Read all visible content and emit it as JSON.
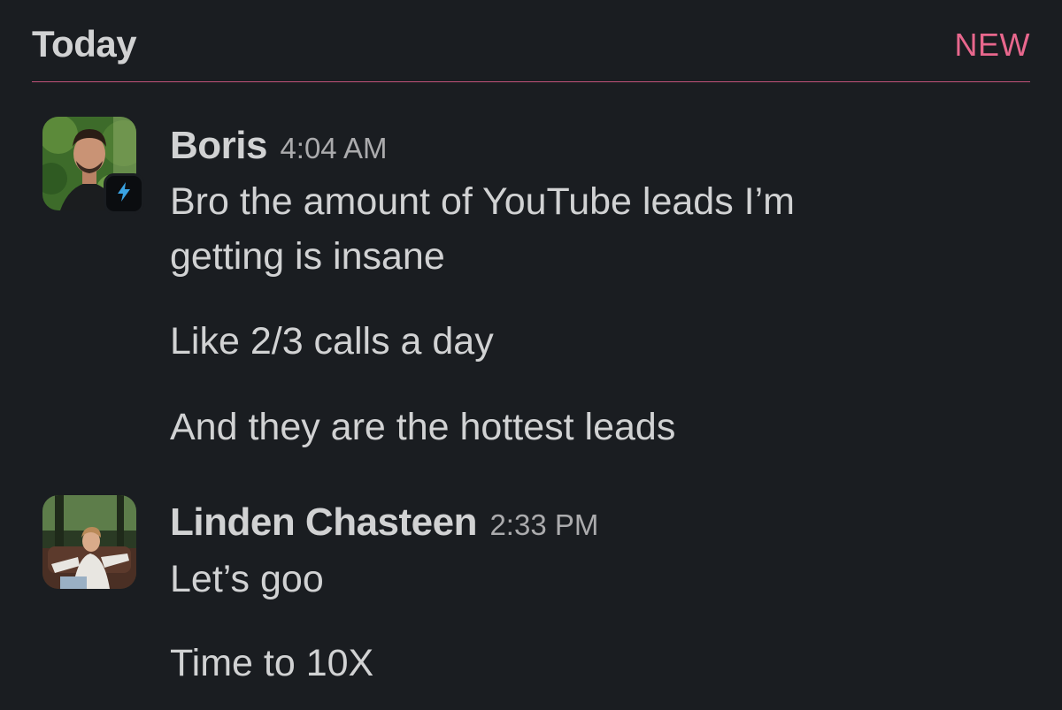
{
  "header": {
    "day_label": "Today",
    "new_label": "NEW",
    "divider_color": "#c2527a",
    "new_color": "#e8678d"
  },
  "messages": [
    {
      "sender": "Boris",
      "time": "4:04 AM",
      "avatar_badge_icon": "lightning-bolt-icon",
      "lines": [
        "Bro the amount of YouTube leads I’m getting is insane",
        "Like 2/3 calls a day",
        "And they are the hottest leads"
      ]
    },
    {
      "sender": "Linden Chasteen",
      "time": "2:33 PM",
      "lines": [
        "Let’s goo",
        "Time to 10X"
      ]
    }
  ]
}
